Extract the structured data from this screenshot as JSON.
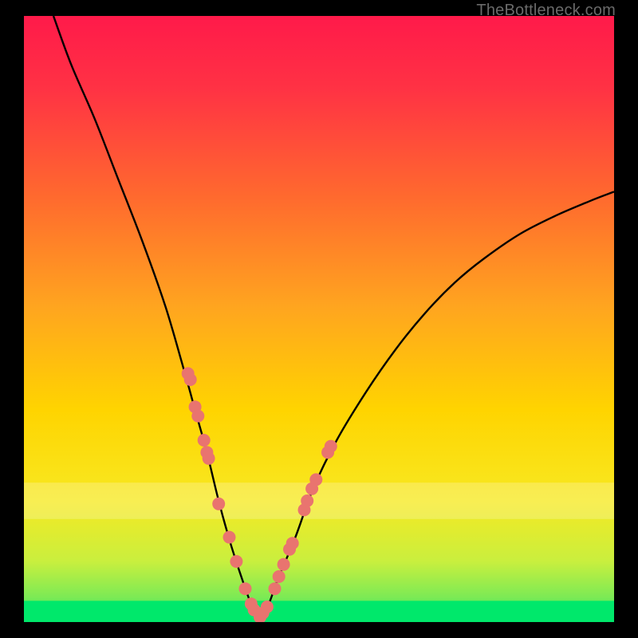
{
  "watermark": "TheBottleneck.com",
  "chart_data": {
    "type": "line",
    "title": "",
    "xlabel": "",
    "ylabel": "",
    "xlim": [
      0,
      100
    ],
    "ylim": [
      0,
      100
    ],
    "grid": false,
    "legend": false,
    "colors": {
      "gradient_top": "#ff1a4a",
      "gradient_mid": "#ffd400",
      "gradient_bottom": "#00e86b",
      "curve": "#000000",
      "marker": "#e9746f"
    },
    "series": [
      {
        "name": "bottleneck-curve",
        "x": [
          5,
          8,
          12,
          16,
          20,
          24,
          27,
          29,
          31,
          33,
          35,
          37,
          38.5,
          40,
          41.5,
          43,
          46,
          49,
          53,
          58,
          63,
          68,
          73,
          78,
          84,
          90,
          96,
          100
        ],
        "y": [
          100,
          92,
          83,
          73,
          63,
          52,
          42,
          35,
          28,
          20,
          13,
          7,
          3,
          0.5,
          3,
          7,
          14,
          22,
          30,
          38,
          45,
          51,
          56,
          60,
          64,
          67,
          69.5,
          71
        ]
      }
    ],
    "markers": {
      "name": "highlighted-points",
      "x": [
        27.8,
        28.2,
        29.0,
        29.5,
        30.5,
        31.0,
        31.3,
        33.0,
        34.8,
        36.0,
        37.5,
        38.5,
        39.0,
        40.0,
        40.5,
        41.2,
        42.5,
        43.2,
        44.0,
        45.0,
        45.5,
        47.5,
        48.0,
        48.8,
        49.5,
        51.5,
        52.0
      ],
      "y": [
        41.0,
        40.0,
        35.5,
        34.0,
        30.0,
        28.0,
        27.0,
        19.5,
        14.0,
        10.0,
        5.5,
        3.0,
        2.0,
        0.8,
        1.5,
        2.5,
        5.5,
        7.5,
        9.5,
        12.0,
        13.0,
        18.5,
        20.0,
        22.0,
        23.5,
        28.0,
        29.0
      ]
    },
    "green_band": {
      "y_from": 0,
      "y_to": 3.5
    },
    "pale_band": {
      "y_from": 17,
      "y_to": 23
    }
  }
}
